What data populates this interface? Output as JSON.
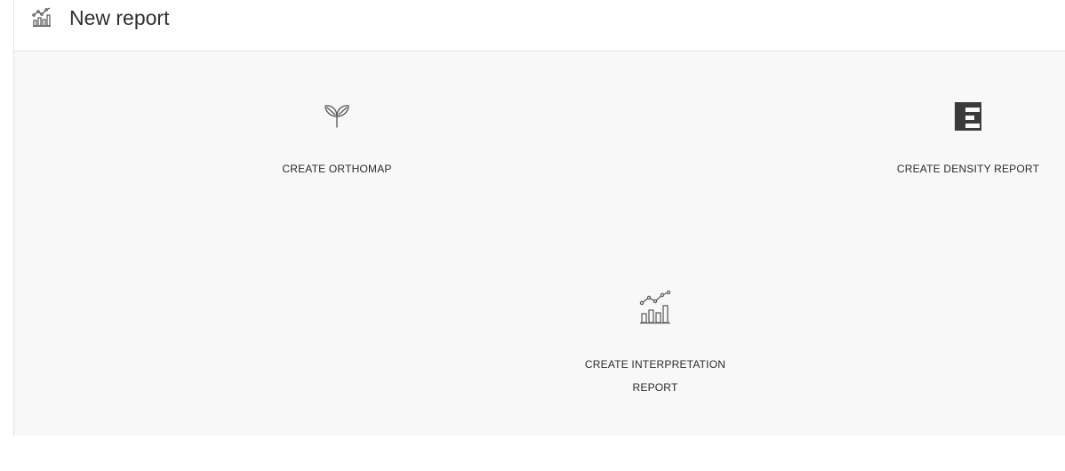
{
  "header": {
    "icon": "chart-report-icon",
    "title": "New report"
  },
  "cards": [
    {
      "id": "orthomap",
      "icon": "sprout-icon",
      "label": "CREATE ORTHOMAP"
    },
    {
      "id": "density",
      "icon": "density-bars-icon",
      "label": "CREATE DENSITY REPORT"
    },
    {
      "id": "interpretation",
      "icon": "chart-report-icon",
      "label": "CREATE INTERPRETATION REPORT"
    }
  ],
  "colors": {
    "content_background": "#f8f8f8",
    "header_background": "#ffffff",
    "text": "#2a2a2a",
    "icon_dark": "#3a3a3a"
  }
}
